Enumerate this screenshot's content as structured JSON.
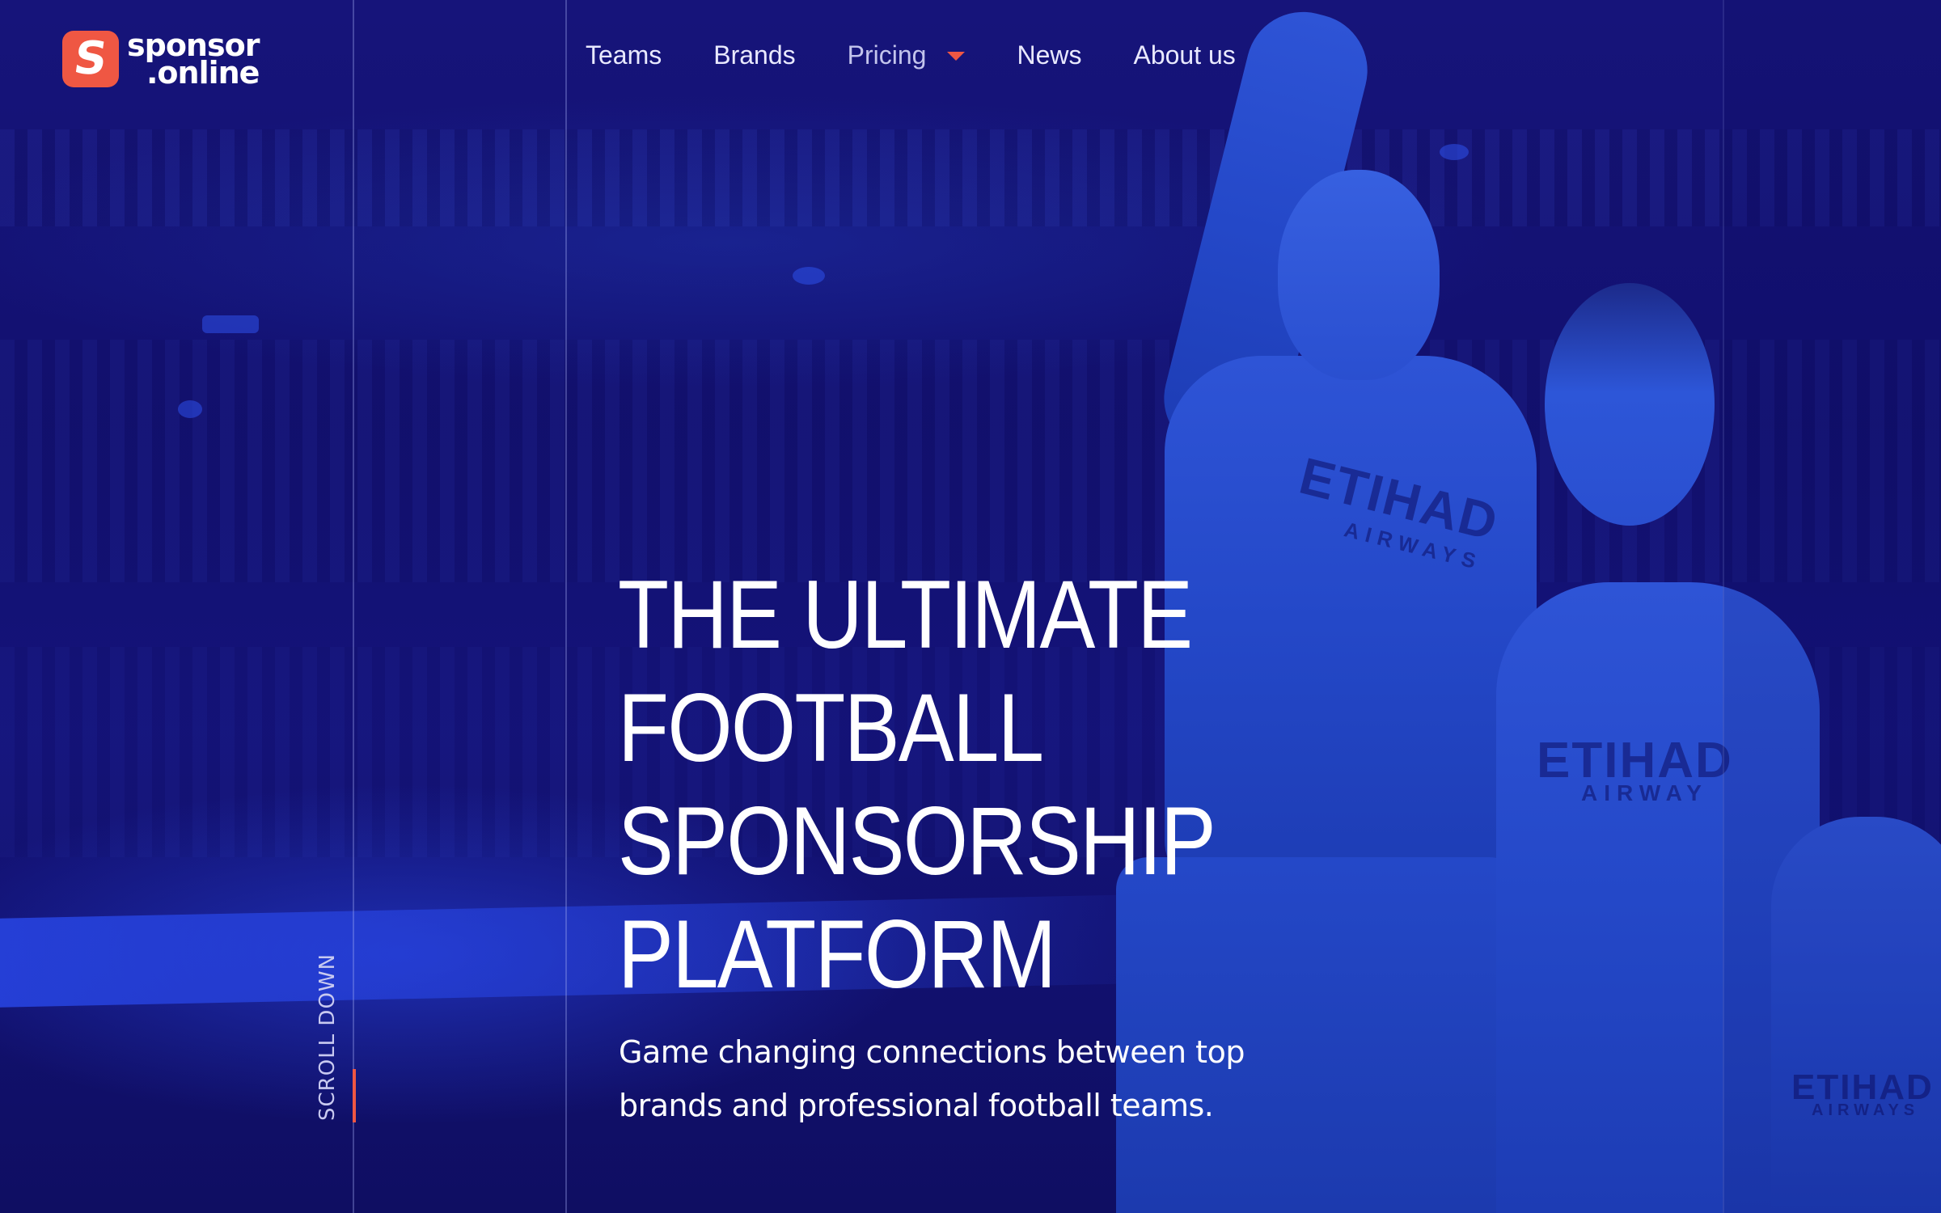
{
  "brand": {
    "logo_glyph": "S",
    "name_line1": "sponsor",
    "name_line2": ".online",
    "accent_color": "#ef5743",
    "background_color": "#10106b"
  },
  "nav": {
    "items": [
      {
        "label": "Teams"
      },
      {
        "label": "Brands"
      },
      {
        "label": "Pricing"
      },
      {
        "label": "News"
      },
      {
        "label": "About us"
      }
    ],
    "dropdown_icon": "chevron-down-icon"
  },
  "hero": {
    "headline_lines": [
      "THE ULTIMATE",
      "FOOTBALL",
      "SPONSORSHIP",
      "PLATFORM"
    ],
    "subtitle_line1": "Game changing connections between top",
    "subtitle_line2": "brands and professional football teams.",
    "scroll_label": "SCROLL DOWN",
    "jersey_text_1": "ETIHAD",
    "jersey_text_1b": "AIRWAYS",
    "jersey_text_2": "ETIHAD",
    "jersey_text_2b": "AIRWAY",
    "jersey_text_3": "ETIHAD",
    "jersey_text_3b": "AIRWAYS"
  }
}
